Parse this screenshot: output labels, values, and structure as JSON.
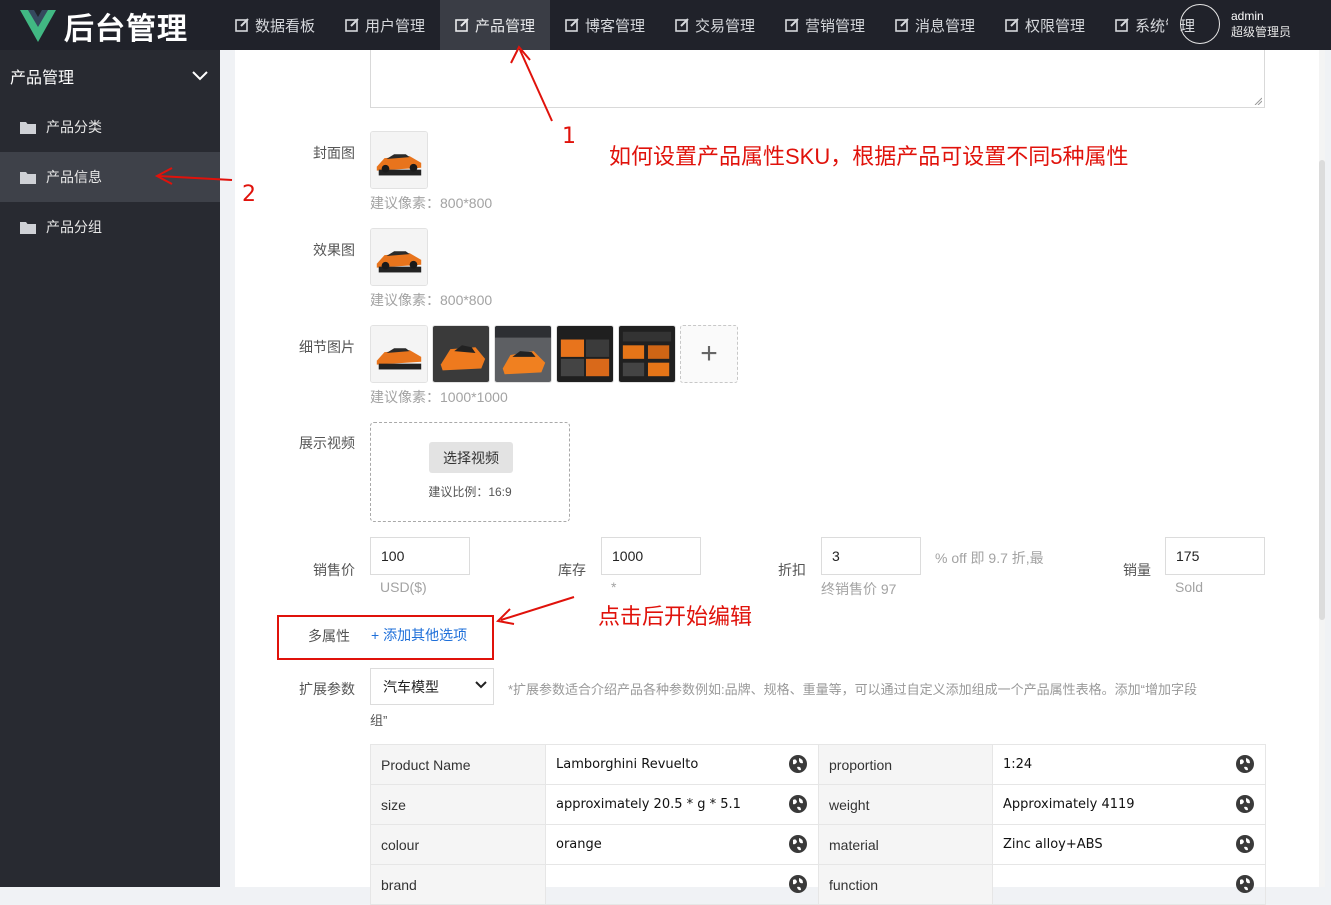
{
  "app": {
    "title": "后台管理"
  },
  "nav": [
    {
      "label": "数据看板"
    },
    {
      "label": "用户管理"
    },
    {
      "label": "产品管理"
    },
    {
      "label": "博客管理"
    },
    {
      "label": "交易管理"
    },
    {
      "label": "营销管理"
    },
    {
      "label": "消息管理"
    },
    {
      "label": "权限管理"
    },
    {
      "label": "系统管理"
    }
  ],
  "nav_active_index": 2,
  "user": {
    "name": "admin",
    "role": "超级管理员"
  },
  "sidebar": {
    "title": "产品管理",
    "items": [
      {
        "label": "产品分类"
      },
      {
        "label": "产品信息"
      },
      {
        "label": "产品分组"
      }
    ],
    "active_index": 1
  },
  "form": {
    "cover_label": "封面图",
    "cover_hint": "建议像素：800*800",
    "effect_label": "效果图",
    "effect_hint": "建议像素：800*800",
    "detail_label": "细节图片",
    "detail_hint": "建议像素：1000*1000",
    "add_plus": "+",
    "video_label": "展示视频",
    "video_button": "选择视频",
    "video_hint": "建议比例：16:9",
    "price_label": "销售价",
    "price_value": "100",
    "price_unit": "USD($)",
    "stock_label": "库存",
    "stock_value": "1000",
    "stock_unit": "*",
    "discount_label": "折扣",
    "discount_value": "3",
    "discount_hint": "% off 即 9.7 折,最",
    "discount_final": "终销售价 97",
    "sales_label": "销量",
    "sales_value": "175",
    "sales_unit": "Sold",
    "multi_attr_label": "多属性",
    "add_option": "+ 添加其他选项",
    "ext_label": "扩展参数",
    "ext_select": "汽车模型",
    "ext_hint_1": "*扩展参数适合介绍产品各种参数例如:品牌、规格、重量等，可以通过自定义添加组成一个产品属性表格。添加“增加字段",
    "ext_hint_2": "组”"
  },
  "params": [
    {
      "k1": "Product Name",
      "v1": "Lamborghini Revuelto",
      "k2": "proportion",
      "v2": "1:24"
    },
    {
      "k1": "size",
      "v1": "approximately 20.5 * g * 5.1",
      "k2": "weight",
      "v2": "Approximately 4119"
    },
    {
      "k1": "colour",
      "v1": "orange",
      "k2": "material",
      "v2": "Zinc alloy+ABS"
    },
    {
      "k1": "brand",
      "v1": "",
      "k2": "function",
      "v2": ""
    }
  ],
  "annotations": {
    "label_1": "1",
    "label_2": "2",
    "note_sku": "如何设置产品属性SKU，根据产品可设置不同5种属性",
    "note_edit": "点击后开始编辑"
  },
  "colors": {
    "topbar": "#20222a",
    "sidebar": "#282a31",
    "annotation": "#e0120b",
    "link": "#1e6fd9",
    "logo_green": "#41b883"
  }
}
